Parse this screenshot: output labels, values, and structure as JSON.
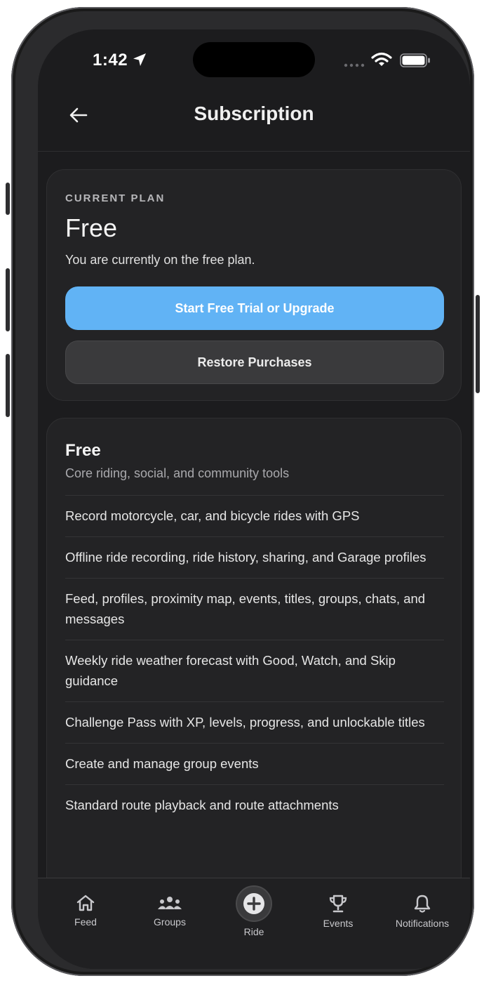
{
  "status_bar": {
    "time": "1:42"
  },
  "header": {
    "title": "Subscription"
  },
  "current_plan": {
    "eyebrow": "CURRENT PLAN",
    "name": "Free",
    "description": "You are currently on the free plan.",
    "primary_button": "Start Free Trial or Upgrade",
    "secondary_button": "Restore Purchases"
  },
  "tier": {
    "name": "Free",
    "subtitle": "Core riding, social, and community tools",
    "features": [
      "Record motorcycle, car, and bicycle rides with GPS",
      "Offline ride recording, ride history, sharing, and Garage profiles",
      "Feed, profiles, proximity map, events, titles, groups, chats, and messages",
      "Weekly ride weather forecast with Good, Watch, and Skip guidance",
      "Challenge Pass with XP, levels, progress, and unlockable titles",
      "Create and manage group events",
      "Standard route playback and route attachments"
    ]
  },
  "tabs": [
    {
      "label": "Feed",
      "icon": "home-icon"
    },
    {
      "label": "Groups",
      "icon": "groups-icon"
    },
    {
      "label": "Ride",
      "icon": "plus-circle-icon"
    },
    {
      "label": "Events",
      "icon": "trophy-icon"
    },
    {
      "label": "Notifications",
      "icon": "bell-icon"
    }
  ],
  "colors": {
    "background": "#1c1c1e",
    "card": "#232325",
    "accent": "#61b3f5",
    "secondary_button": "#3a3a3c"
  }
}
